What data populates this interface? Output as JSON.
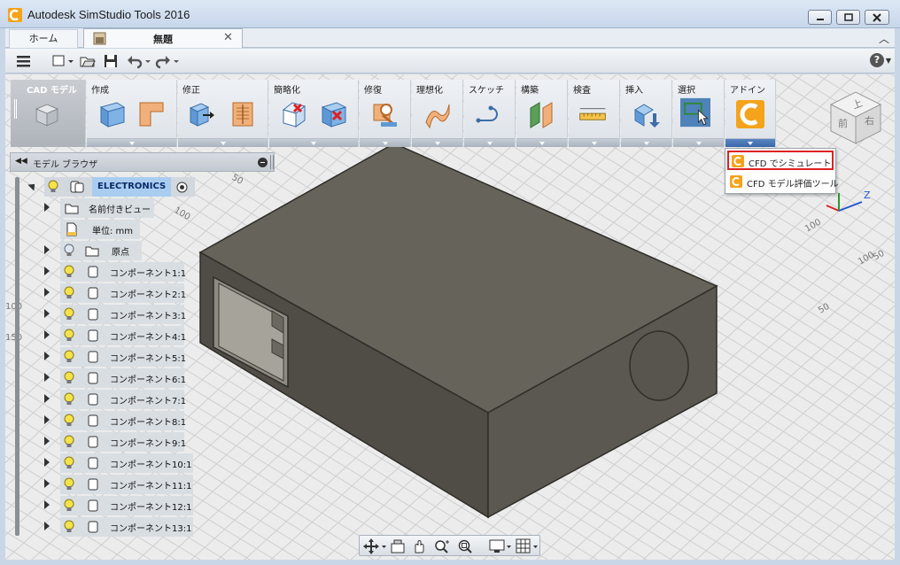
{
  "window": {
    "title": "Autodesk SimStudio Tools 2016",
    "controls": [
      "minimize-icon",
      "maximize-icon",
      "close-icon"
    ]
  },
  "tabs": {
    "home_label": "ホーム",
    "doc_label": "無題",
    "doc_close": "✕",
    "collapse": "︿"
  },
  "quick_access": {
    "items": [
      "menu-icon",
      "new-file-icon",
      "open-icon",
      "save-icon",
      "undo-icon",
      "redo-icon"
    ],
    "help": "?"
  },
  "ribbon": {
    "groups": [
      {
        "label": "CAD モデル"
      },
      {
        "label": "作成"
      },
      {
        "label": "修正"
      },
      {
        "label": "簡略化"
      },
      {
        "label": "修復"
      },
      {
        "label": "理想化"
      },
      {
        "label": "スケッチ"
      },
      {
        "label": "構築"
      },
      {
        "label": "検査"
      },
      {
        "label": "挿入"
      },
      {
        "label": "選択"
      },
      {
        "label": "アドイン"
      }
    ]
  },
  "addin_menu": {
    "items": [
      {
        "label": "CFD でシミュレート",
        "selected": true
      },
      {
        "label": "CFD モデル評価ツール",
        "selected": false
      }
    ]
  },
  "browser": {
    "title": "モデル ブラウザ",
    "root": "ELECTRONICS",
    "named_views": "名前付きビュー",
    "units": "単位: mm",
    "origin": "原点",
    "components": [
      "コンポーネント1:1",
      "コンポーネント2:1",
      "コンポーネント3:1",
      "コンポーネント4:1",
      "コンポーネント5:1",
      "コンポーネント6:1",
      "コンポーネント7:1",
      "コンポーネント8:1",
      "コンポーネント9:1",
      "コンポーネント10:1",
      "コンポーネント11:1",
      "コンポーネント12:1",
      "コンポーネント13:1"
    ]
  },
  "viewport": {
    "grid_labels": [
      "100",
      "50",
      "100",
      "50",
      "100",
      "50",
      "100",
      "150"
    ],
    "background": "#ececec",
    "model_color": "#5b5950"
  },
  "viewcube": {
    "top": "上",
    "front": "前",
    "right": "右"
  },
  "triad": {
    "z": "Z"
  },
  "navbar": {
    "tools": [
      "orbit-icon",
      "look-at-icon",
      "pan-icon",
      "zoom-window-icon",
      "fit-icon",
      "display-settings-icon",
      "grid-settings-icon"
    ]
  }
}
